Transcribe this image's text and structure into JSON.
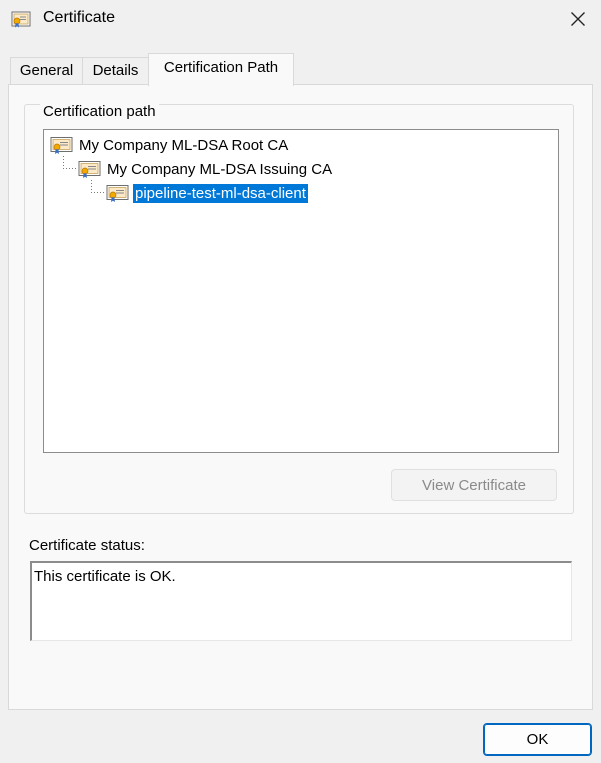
{
  "window": {
    "title": "Certificate",
    "title_icon": "certificate-icon",
    "close_icon": "close-icon"
  },
  "tabs": [
    {
      "label": "General",
      "active": false
    },
    {
      "label": "Details",
      "active": false
    },
    {
      "label": "Certification Path",
      "active": true
    }
  ],
  "certification_path": {
    "group_label": "Certification path",
    "nodes": [
      {
        "label": "My Company ML-DSA Root CA",
        "level": 0,
        "selected": false
      },
      {
        "label": "My Company ML-DSA Issuing CA",
        "level": 1,
        "selected": false
      },
      {
        "label": "pipeline-test-ml-dsa-client",
        "level": 2,
        "selected": true
      }
    ],
    "view_button_label": "View Certificate",
    "view_button_enabled": false
  },
  "status": {
    "label": "Certificate status:",
    "text": "This certificate is OK."
  },
  "footer": {
    "ok_label": "OK"
  },
  "colors": {
    "selection": "#0078d7",
    "ok_border": "#0067c0",
    "background": "#f0f0f0",
    "panel": "#f9f9f9"
  }
}
